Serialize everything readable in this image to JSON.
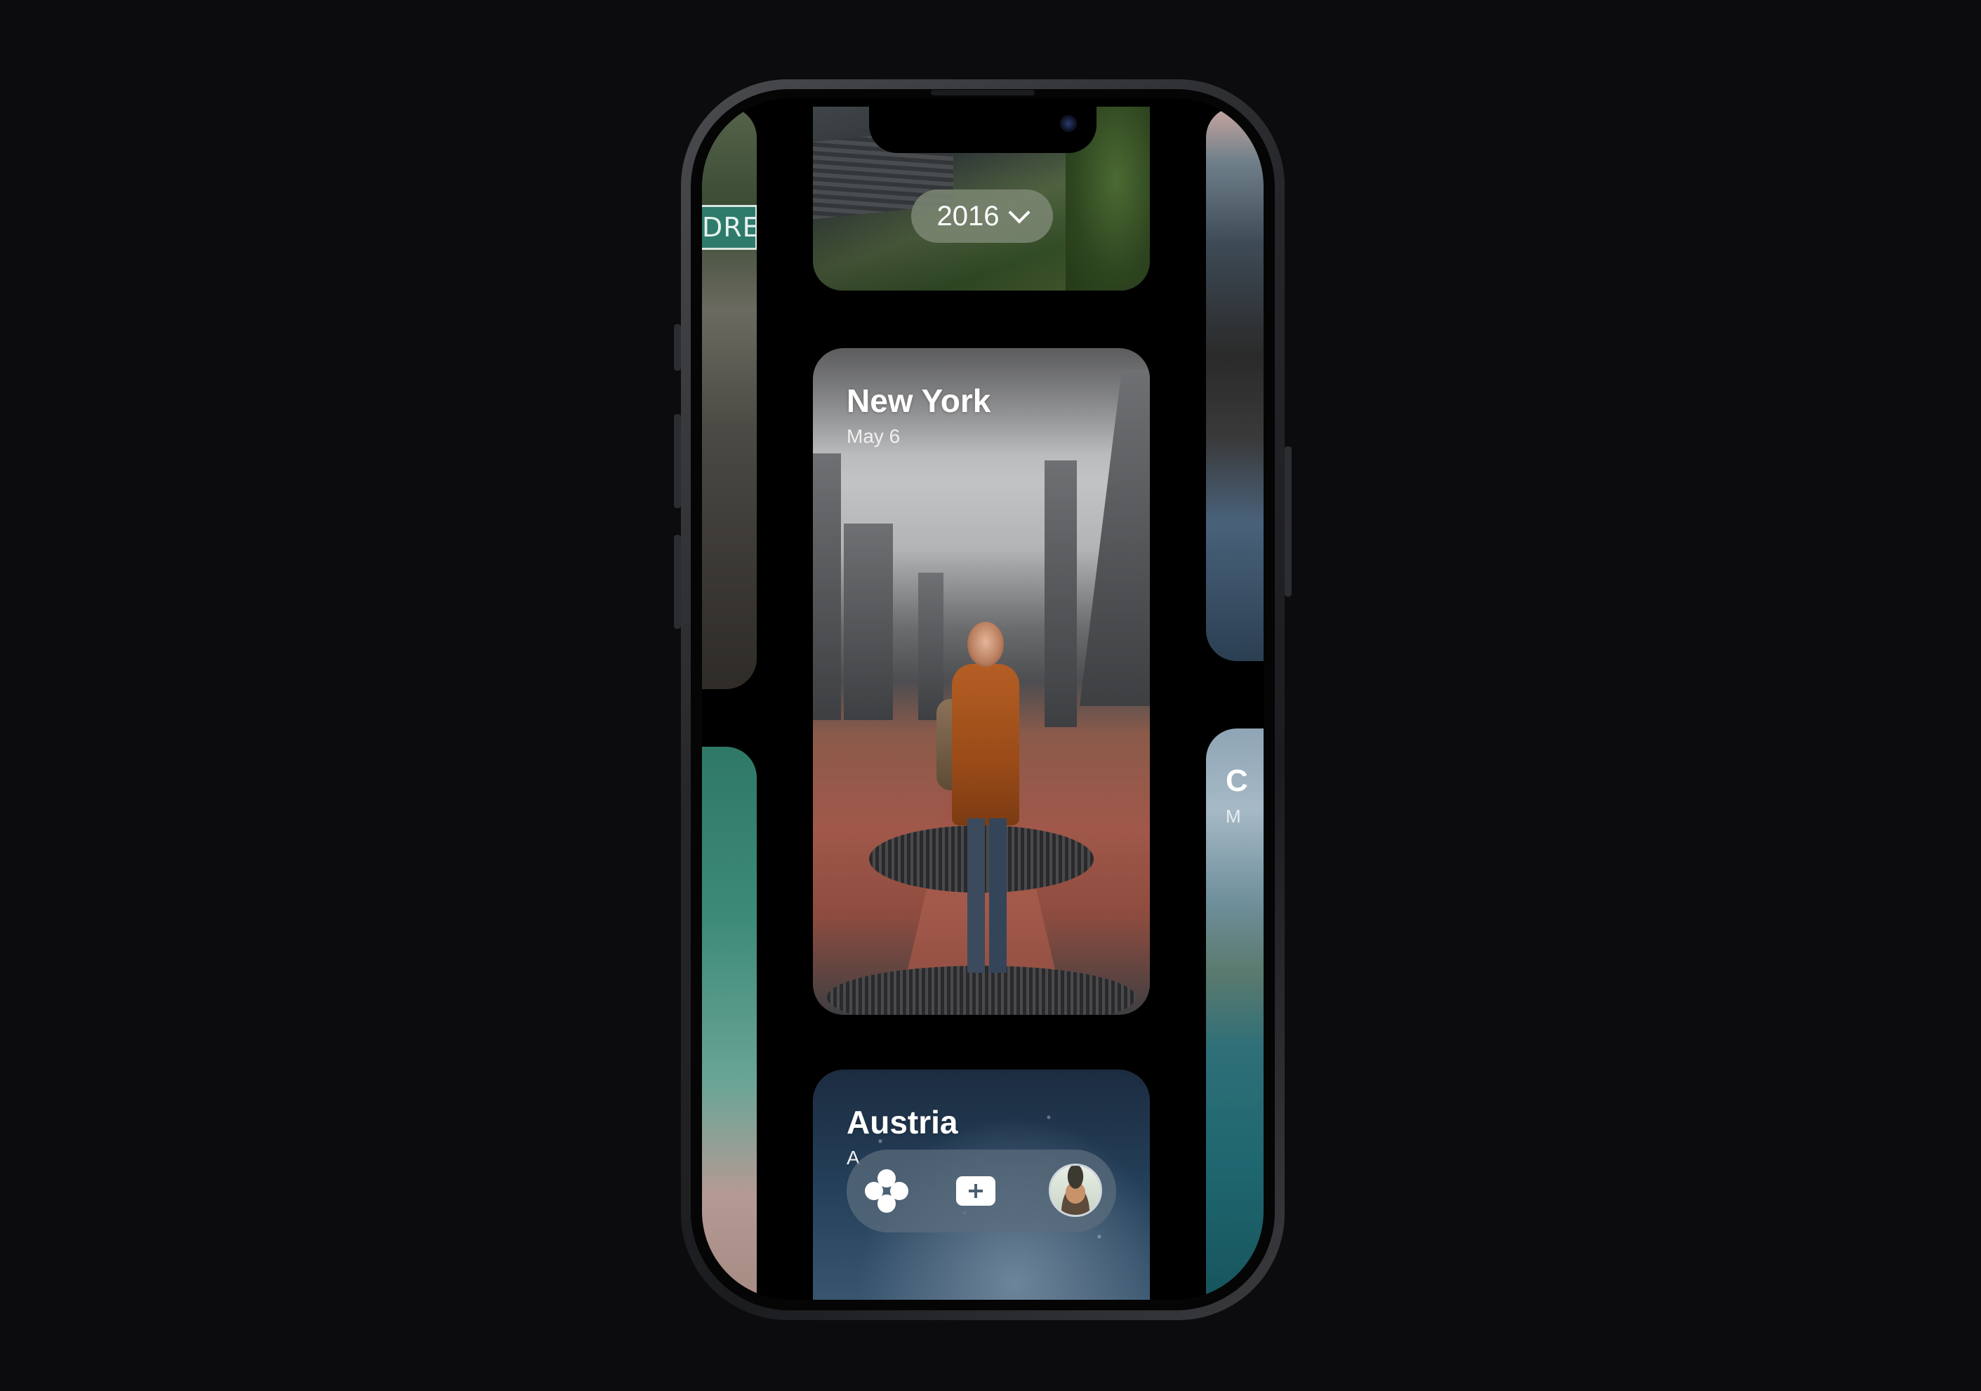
{
  "year_selector": {
    "year": "2016",
    "chevron_icon": "chevron-down-icon"
  },
  "cards": {
    "new_york": {
      "title": "New York",
      "date": "May 6"
    },
    "austria": {
      "title": "Austria",
      "date": "A"
    }
  },
  "side_cards": {
    "left_sign": "DREAM",
    "right_peek": {
      "title": "C",
      "date": "M"
    }
  },
  "tabbar": {
    "items": [
      {
        "icon": "clover-icon"
      },
      {
        "icon": "add-square-icon"
      },
      {
        "icon": "profile-avatar"
      }
    ]
  },
  "colors": {
    "background": "#0c0c0e",
    "pill": "#7d8773",
    "tabbar": "#5c6e7d"
  }
}
